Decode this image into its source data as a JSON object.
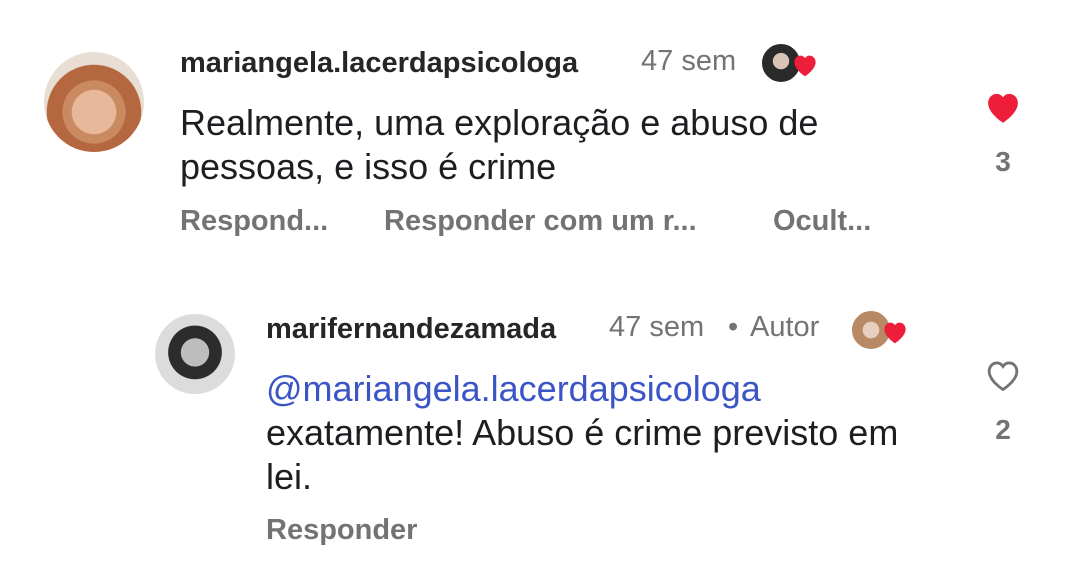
{
  "comments": [
    {
      "username": "mariangela.lacerdapsicologa",
      "time": "47 sem",
      "text": "Realmente, uma exploração e abuso de pessoas, e isso é crime",
      "actions": [
        "Respond...",
        "Responder com um r...",
        "Ocult..."
      ],
      "likes": "3",
      "liked": true
    }
  ],
  "reply": {
    "username": "marifernandezamada",
    "time": "47 sem",
    "separator": "•",
    "author_badge": "Autor",
    "mention": "@mariangela.lacerdapsicologa",
    "text": "exatamente! Abuso é crime previsto em lei.",
    "action": "Responder",
    "likes": "2",
    "liked": false
  },
  "colors": {
    "heart": "#ee1d3a",
    "mention": "#3b55c5",
    "muted": "#737373"
  }
}
